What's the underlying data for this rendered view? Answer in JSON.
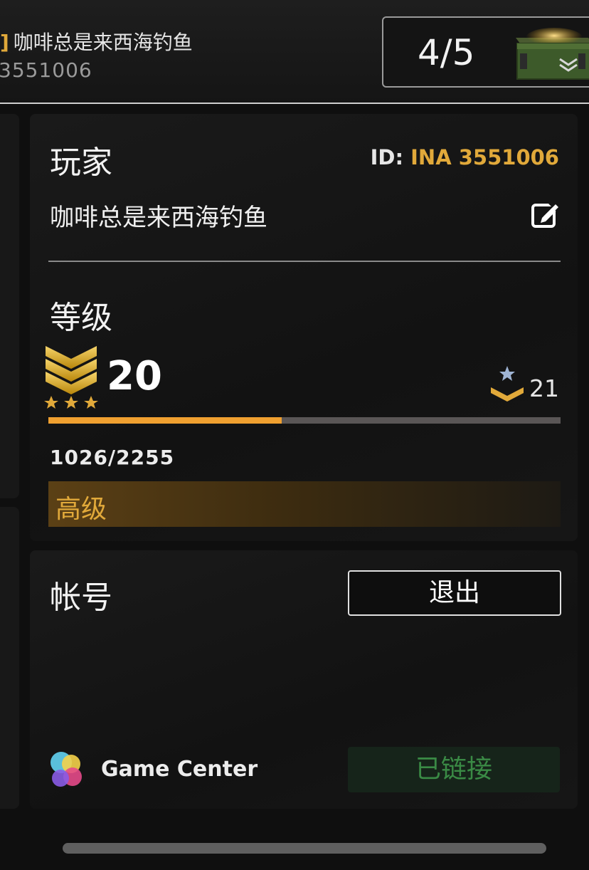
{
  "topbar": {
    "name": "咖啡总是来西海钓鱼",
    "id_partial": "3551006",
    "crate_count": "4/5",
    "crate_icon": "ammo-crate-icon"
  },
  "player": {
    "section_label": "玩家",
    "id_prefix": "ID: ",
    "id_value": "INA 3551006",
    "name": "咖啡总是来西海钓鱼",
    "edit_icon": "edit-icon"
  },
  "level": {
    "section_label": "等级",
    "rank_icon": "sergeant-chevron-icon",
    "current": "20",
    "next_rank_icon": "next-rank-chevron-icon",
    "next": "21",
    "xp_text": "1026/2255",
    "xp_fraction": 0.455,
    "tier": "高级"
  },
  "account": {
    "section_label": "帐号",
    "logout_label": "退出",
    "game_center_label": "Game Center",
    "game_center_icon": "game-center-icon",
    "linked_label": "已链接"
  },
  "colors": {
    "accent_gold": "#e1a93a",
    "xp_fill": "#f0a030",
    "linked_green": "#3a8a45"
  }
}
